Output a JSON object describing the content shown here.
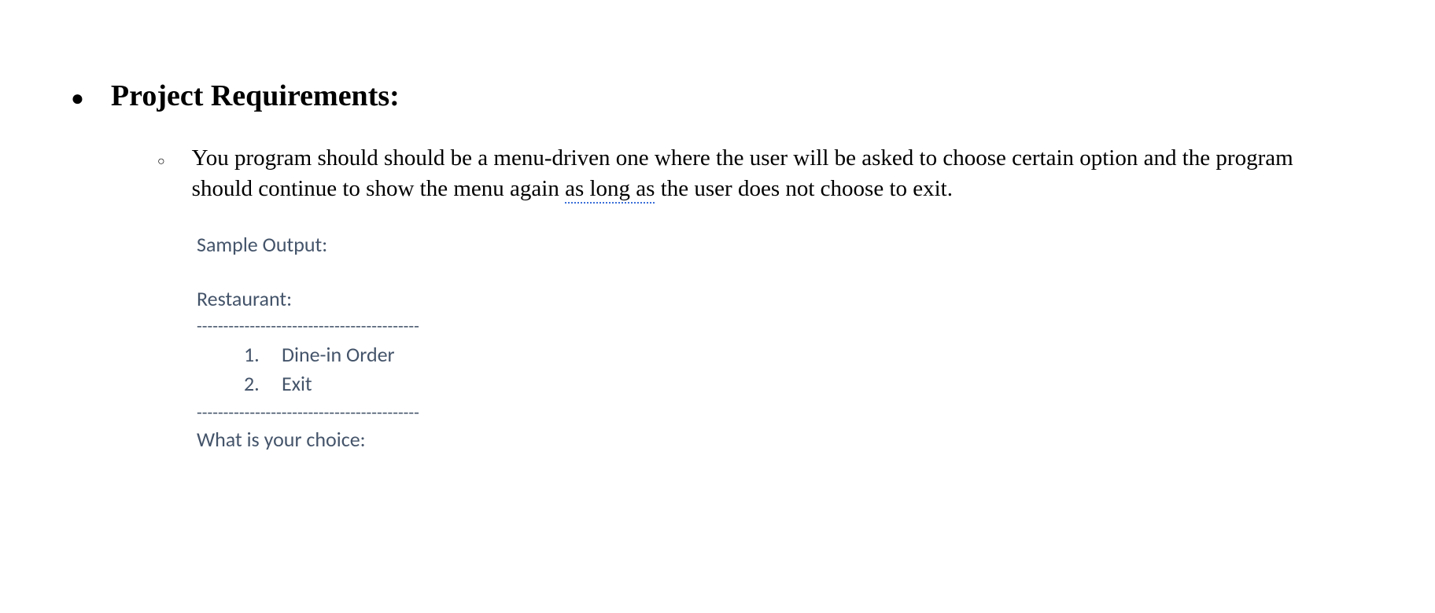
{
  "heading": "Project Requirements:",
  "paragraph_before": "You program should should be a menu-driven one where the user will be asked to choose certain option and the program should continue to show the menu again ",
  "paragraph_underlined": "as long as",
  "paragraph_after": " the user does not choose to exit.",
  "sample": {
    "label": "Sample Output:",
    "restaurant_label": "Restaurant:",
    "divider": "------------------------------------------",
    "menu_items": [
      {
        "num": "1.",
        "text": "Dine-in Order"
      },
      {
        "num": "2.",
        "text": "Exit"
      }
    ],
    "prompt": "What is your choice:"
  }
}
